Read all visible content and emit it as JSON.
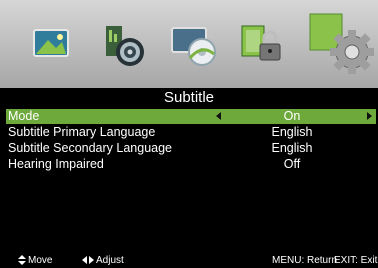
{
  "menu_icons": [
    {
      "icon": "picture-icon",
      "selected": false
    },
    {
      "icon": "sound-icon",
      "selected": false
    },
    {
      "icon": "channel-icon",
      "selected": false
    },
    {
      "icon": "lock-icon",
      "selected": false
    },
    {
      "icon": "setup-gear-icon",
      "selected": true
    }
  ],
  "page_title": "Subtitle",
  "rows": [
    {
      "label": "Mode",
      "value": "On",
      "selected": true
    },
    {
      "label": "Subtitle Primary Language",
      "value": "English",
      "selected": false
    },
    {
      "label": "Subtitle Secondary Language",
      "value": "English",
      "selected": false
    },
    {
      "label": "Hearing Impaired",
      "value": "Off",
      "selected": false
    }
  ],
  "footer": {
    "move": "Move",
    "adjust": "Adjust",
    "menu": "MENU: Return",
    "exit": "EXIT: Exit"
  },
  "colors": {
    "selection": "#6ea93c",
    "background": "#000000"
  }
}
